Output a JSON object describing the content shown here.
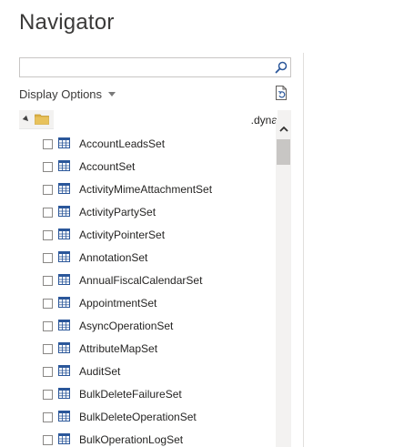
{
  "window": {
    "title": "Navigator"
  },
  "search": {
    "value": "",
    "placeholder": "",
    "icon": "search-icon"
  },
  "toolbar": {
    "display_options_label": "Display Options",
    "display_options_icon": "chevron-down-icon",
    "refresh_icon": "refresh-document-icon"
  },
  "tree": {
    "root": {
      "expanded": true,
      "icon": "folder-icon",
      "label": ".dyna"
    },
    "items": [
      {
        "label": "AccountLeadsSet",
        "checked": false,
        "icon": "table-icon"
      },
      {
        "label": "AccountSet",
        "checked": false,
        "icon": "table-icon"
      },
      {
        "label": "ActivityMimeAttachmentSet",
        "checked": false,
        "icon": "table-icon"
      },
      {
        "label": "ActivityPartySet",
        "checked": false,
        "icon": "table-icon"
      },
      {
        "label": "ActivityPointerSet",
        "checked": false,
        "icon": "table-icon"
      },
      {
        "label": "AnnotationSet",
        "checked": false,
        "icon": "table-icon"
      },
      {
        "label": "AnnualFiscalCalendarSet",
        "checked": false,
        "icon": "table-icon"
      },
      {
        "label": "AppointmentSet",
        "checked": false,
        "icon": "table-icon"
      },
      {
        "label": "AsyncOperationSet",
        "checked": false,
        "icon": "table-icon"
      },
      {
        "label": "AttributeMapSet",
        "checked": false,
        "icon": "table-icon"
      },
      {
        "label": "AuditSet",
        "checked": false,
        "icon": "table-icon"
      },
      {
        "label": "BulkDeleteFailureSet",
        "checked": false,
        "icon": "table-icon"
      },
      {
        "label": "BulkDeleteOperationSet",
        "checked": false,
        "icon": "table-icon"
      },
      {
        "label": "BulkOperationLogSet",
        "checked": false,
        "icon": "table-icon"
      }
    ]
  },
  "colors": {
    "folder": "#dcb046",
    "table_icon": "#2b579a",
    "search_icon": "#2b579a"
  }
}
